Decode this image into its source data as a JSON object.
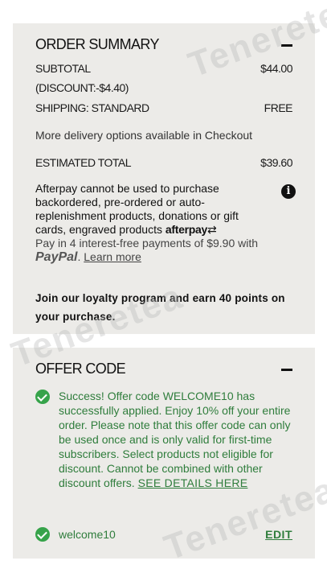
{
  "summary": {
    "title": "ORDER SUMMARY",
    "subtotal_label": "SUBTOTAL",
    "subtotal_value": "$44.00",
    "discount_label": "(DISCOUNT:-$4.40)",
    "shipping_label": "SHIPPING: STANDARD",
    "shipping_value": "FREE",
    "delivery_note": "More delivery options available in Checkout",
    "total_label": "ESTIMATED TOTAL",
    "total_value": "$39.60",
    "afterpay_text": "Afterpay cannot be used to purchase backordered, pre-ordered or auto-replenishment products, donations or gift cards, engraved products",
    "afterpay_logo": "afterpay",
    "paypal_text": "Pay in 4 interest-free payments of $9.90 with",
    "paypal_logo": "PayPal",
    "learn_more": "Learn more",
    "loyalty_text": "Join our loyalty program and earn 40 points on your purchase."
  },
  "offer": {
    "title": "OFFER CODE",
    "success_text": "Success! Offer code WELCOME10 has successfully applied. Enjoy 10% off your entire order. Please note that this offer code can only be used once and is only valid for first-time subscribers. Select products not eligible for discount. Cannot be combined with other discount offers.",
    "see_details": "SEE DETAILS HERE",
    "applied_code": "welcome10",
    "edit_label": "EDIT"
  },
  "icons": {
    "collapse": "minus-icon",
    "info": "info-icon",
    "success": "check-circle-icon"
  },
  "colors": {
    "panel_bg": "#ecebe8",
    "success_green": "#2f7d3c",
    "check_green": "#36a34a"
  },
  "watermark": "Teneretea"
}
